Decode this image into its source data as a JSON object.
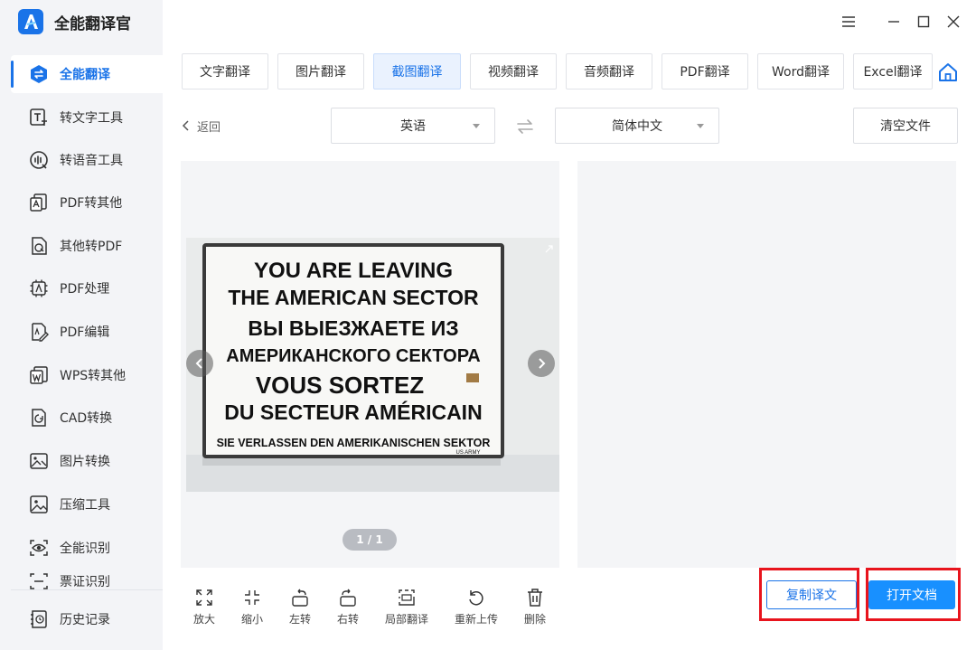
{
  "app": {
    "title": "全能翻译官"
  },
  "sidebar": {
    "items": [
      {
        "label": "全能翻译",
        "icon": "translate-icon",
        "active": true
      },
      {
        "label": "转文字工具",
        "icon": "text-tool-icon"
      },
      {
        "label": "转语音工具",
        "icon": "voice-tool-icon"
      },
      {
        "label": "PDF转其他",
        "icon": "pdf-convert-icon"
      },
      {
        "label": "其他转PDF",
        "icon": "to-pdf-icon"
      },
      {
        "label": "PDF处理",
        "icon": "pdf-process-icon"
      },
      {
        "label": "PDF编辑",
        "icon": "pdf-edit-icon"
      },
      {
        "label": "WPS转其他",
        "icon": "wps-convert-icon"
      },
      {
        "label": "CAD转换",
        "icon": "cad-convert-icon"
      },
      {
        "label": "图片转换",
        "icon": "image-convert-icon"
      },
      {
        "label": "压缩工具",
        "icon": "compress-icon"
      },
      {
        "label": "全能识别",
        "icon": "recognize-icon"
      },
      {
        "label": "票证识别",
        "icon": "ticket-icon",
        "partially_hidden": true
      }
    ],
    "history": {
      "label": "历史记录",
      "icon": "history-icon"
    }
  },
  "tabs": [
    {
      "label": "文字翻译"
    },
    {
      "label": "图片翻译"
    },
    {
      "label": "截图翻译",
      "active": true
    },
    {
      "label": "视频翻译"
    },
    {
      "label": "音频翻译"
    },
    {
      "label": "PDF翻译"
    },
    {
      "label": "Word翻译"
    },
    {
      "label": "Excel翻译"
    }
  ],
  "toolbar": {
    "back_label": "返回",
    "source_lang": "英语",
    "target_lang": "简体中文",
    "clear_label": "清空文件"
  },
  "preview": {
    "sign_lines": [
      "YOU ARE LEAVING",
      "THE AMERICAN SECTOR",
      "ВЫ ВЫЕЗЖАЕТЕ ИЗ",
      "АМЕРИКАНСКОГО СЕКТОРА",
      "VOUS SORTEZ",
      "DU SECTEUR AMÉRICAIN",
      "SIE VERLASSEN DEN AMERIKANISCHEN SEKTOR"
    ],
    "sign_footer": "US ARMY",
    "pager": "1 / 1"
  },
  "tools": [
    {
      "label": "放大",
      "icon": "zoom-in-icon"
    },
    {
      "label": "缩小",
      "icon": "zoom-out-icon"
    },
    {
      "label": "左转",
      "icon": "rotate-left-icon"
    },
    {
      "label": "右转",
      "icon": "rotate-right-icon"
    },
    {
      "label": "局部翻译",
      "icon": "partial-translate-icon"
    },
    {
      "label": "重新上传",
      "icon": "reupload-icon"
    },
    {
      "label": "删除",
      "icon": "trash-icon"
    }
  ],
  "actions": {
    "copy_label": "复制译文",
    "open_label": "打开文档"
  },
  "colors": {
    "accent": "#1a73e8",
    "primary_button": "#1890ff",
    "highlight": "#e8141d",
    "sidebar_bg": "#f3f4f7",
    "panel_bg": "#f4f5f7"
  }
}
